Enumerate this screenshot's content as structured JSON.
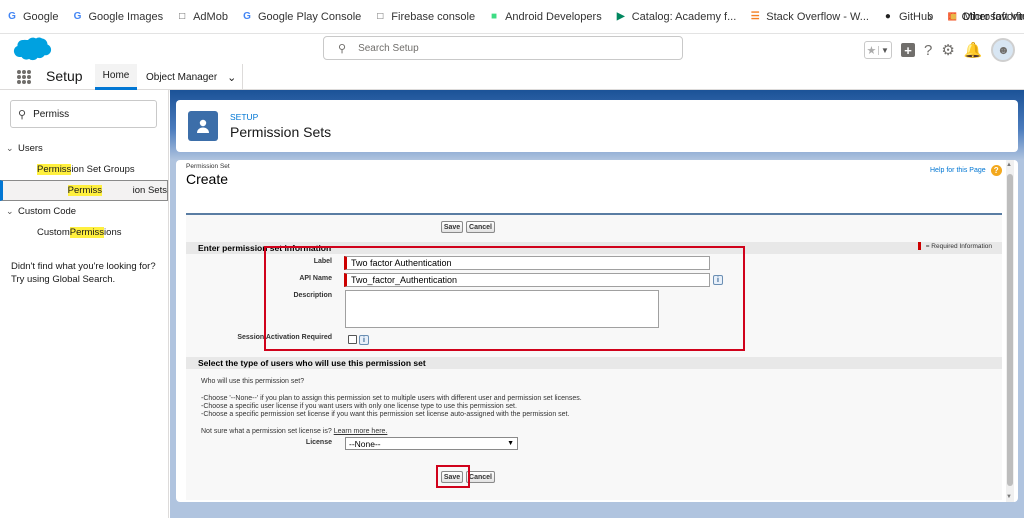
{
  "bookmarks": [
    {
      "label": "Google",
      "icon": "google-icon"
    },
    {
      "label": "Google Images",
      "icon": "google-icon"
    },
    {
      "label": "AdMob",
      "icon": "page-icon"
    },
    {
      "label": "Google Play Console",
      "icon": "google-icon"
    },
    {
      "label": "Firebase console",
      "icon": "page-icon"
    },
    {
      "label": "Android Developers",
      "icon": "android-icon"
    },
    {
      "label": "Catalog: Academy f...",
      "icon": "play-icon"
    },
    {
      "label": "Stack Overflow - W...",
      "icon": "stackoverflow-icon"
    },
    {
      "label": "GitHub",
      "icon": "github-icon"
    },
    {
      "label": "Microsoft Virtual Ac...",
      "icon": "microsoft-icon"
    },
    {
      "label": "Developer",
      "icon": "folder-icon"
    }
  ],
  "other_favorites": "Other favorites",
  "header": {
    "search_placeholder": "Search Setup"
  },
  "nav": {
    "app_title": "Setup",
    "tab_home": "Home",
    "tab_object_manager": "Object Manager"
  },
  "sidebar": {
    "quick_find_value": "Permiss",
    "group_users": "Users",
    "item_psg": {
      "pre": "",
      "hl": "Permiss",
      "post": "ion Set Groups"
    },
    "item_ps": {
      "pre": "",
      "hl": "Permiss",
      "post": "ion Sets"
    },
    "group_custom_code": "Custom Code",
    "item_cp": {
      "pre": "Custom ",
      "hl": "Permiss",
      "post": "ions"
    },
    "not_found_line1": "Didn't find what you're looking for?",
    "not_found_line2": "Try using Global Search."
  },
  "page_header": {
    "setup_label": "SETUP",
    "title": "Permission Sets"
  },
  "form": {
    "caption": "Permission Set",
    "title": "Create",
    "help_link": "Help for this Page",
    "save": "Save",
    "cancel": "Cancel",
    "section1": "Enter permission set information",
    "required_info": "= Required Information",
    "label_label": "Label",
    "label_value": "Two factor Authentication",
    "api_label": "API Name",
    "api_value": "Two_factor_Authentication",
    "description_label": "Description",
    "session_label": "Session Activation Required",
    "section2": "Select the type of users who will use this permission set",
    "q_who": "Who will use this permission set?",
    "choose1": "-Choose '--None--' if you plan to assign this permission set to multiple users with different user and permission set licenses.",
    "choose2": "-Choose a specific user license if you want users with only one license type to use this permission set.",
    "choose3": "-Choose a specific permission set license if you want this permission set license auto-assigned with the permission set.",
    "not_sure": "Not sure what a permission set license is?",
    "learn_more": "Learn more here.",
    "license_label": "License",
    "license_value": "--None--"
  },
  "colors": {
    "accent": "#0176d3",
    "highlight_box": "#d0021b",
    "banner": "#1b5297"
  }
}
